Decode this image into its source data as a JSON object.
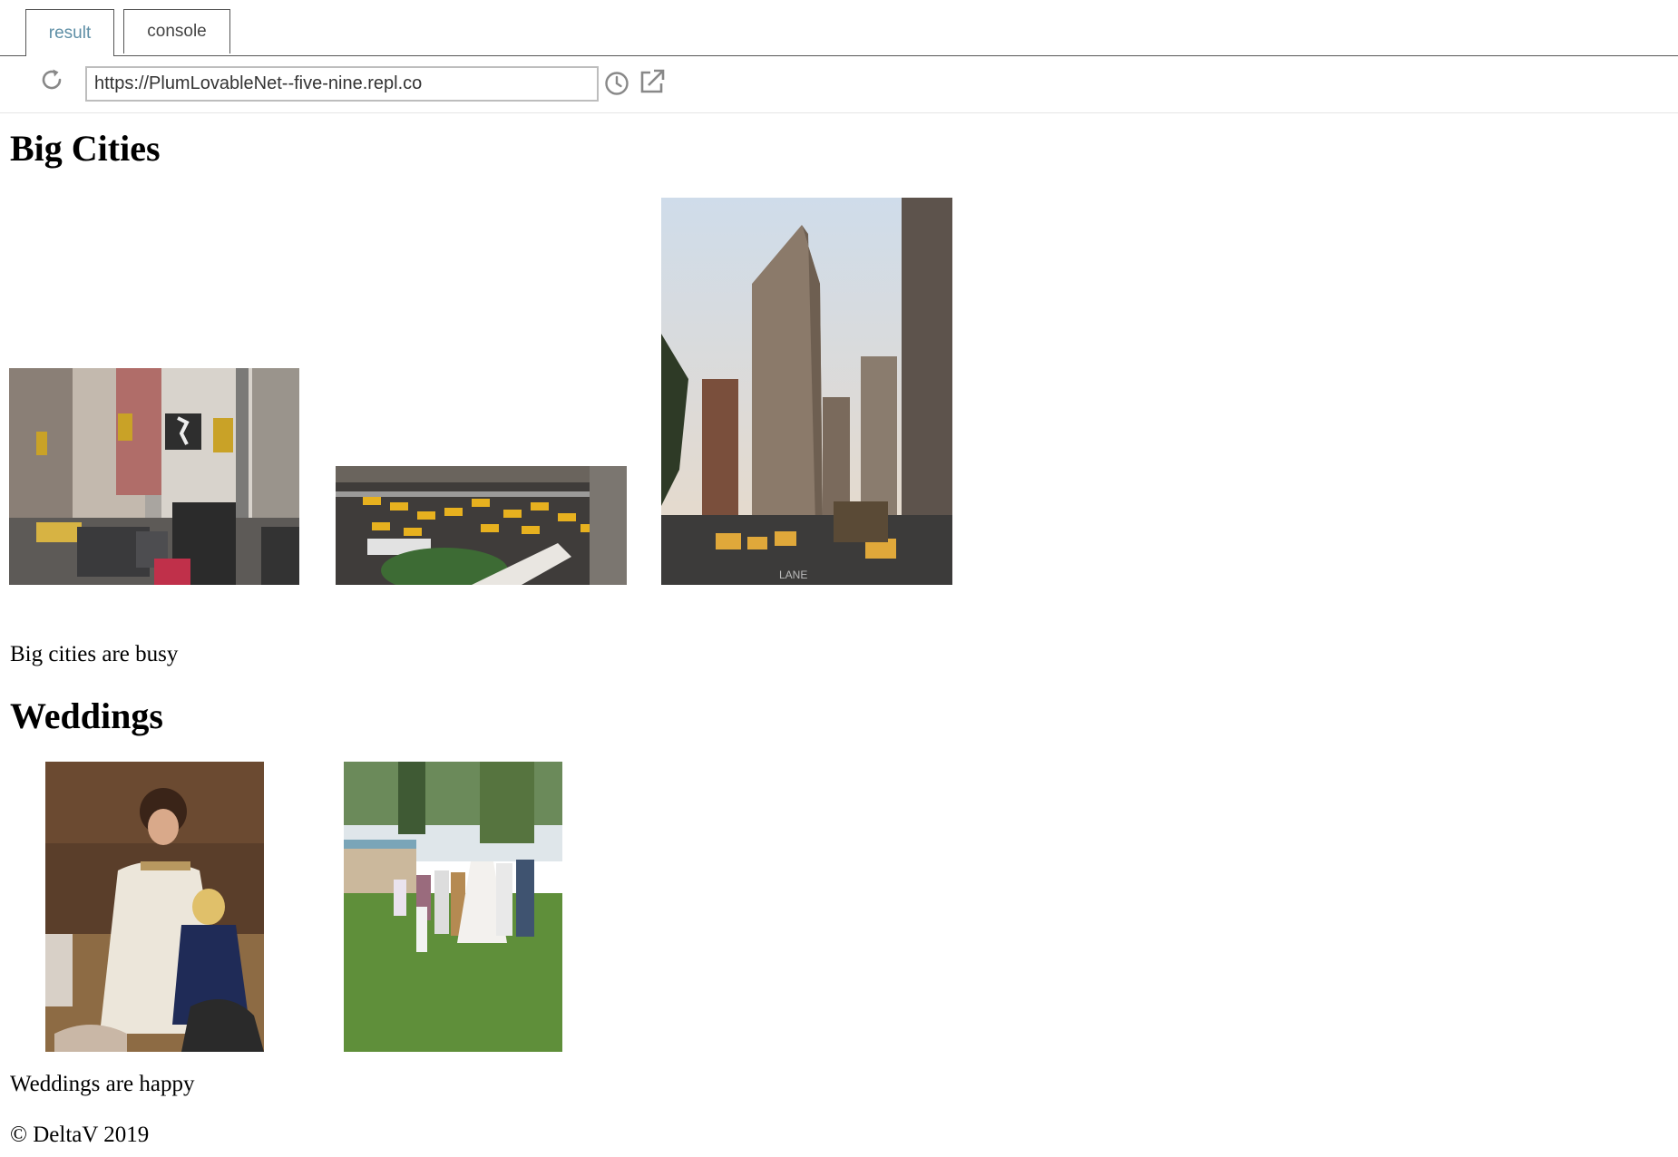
{
  "tabs": [
    {
      "label": "result",
      "active": true
    },
    {
      "label": "console",
      "active": false
    }
  ],
  "address_bar": {
    "url": "https://PlumLovableNet--five-nine.repl.co"
  },
  "page": {
    "sections": [
      {
        "heading": "Big Cities",
        "caption": "Big cities are busy",
        "photos": [
          "city-street-photo",
          "aerial-intersection-photo",
          "flatiron-building-photo"
        ]
      },
      {
        "heading": "Weddings",
        "caption": "Weddings are happy",
        "photos": [
          "bride-and-flower-girl-photo",
          "wedding-party-photo"
        ]
      }
    ],
    "footer": "© DeltaV 2019"
  },
  "colors": {
    "active_tab_text": "#5f8fa6",
    "tab_border": "#555555",
    "url_border": "#bdbdbd"
  }
}
